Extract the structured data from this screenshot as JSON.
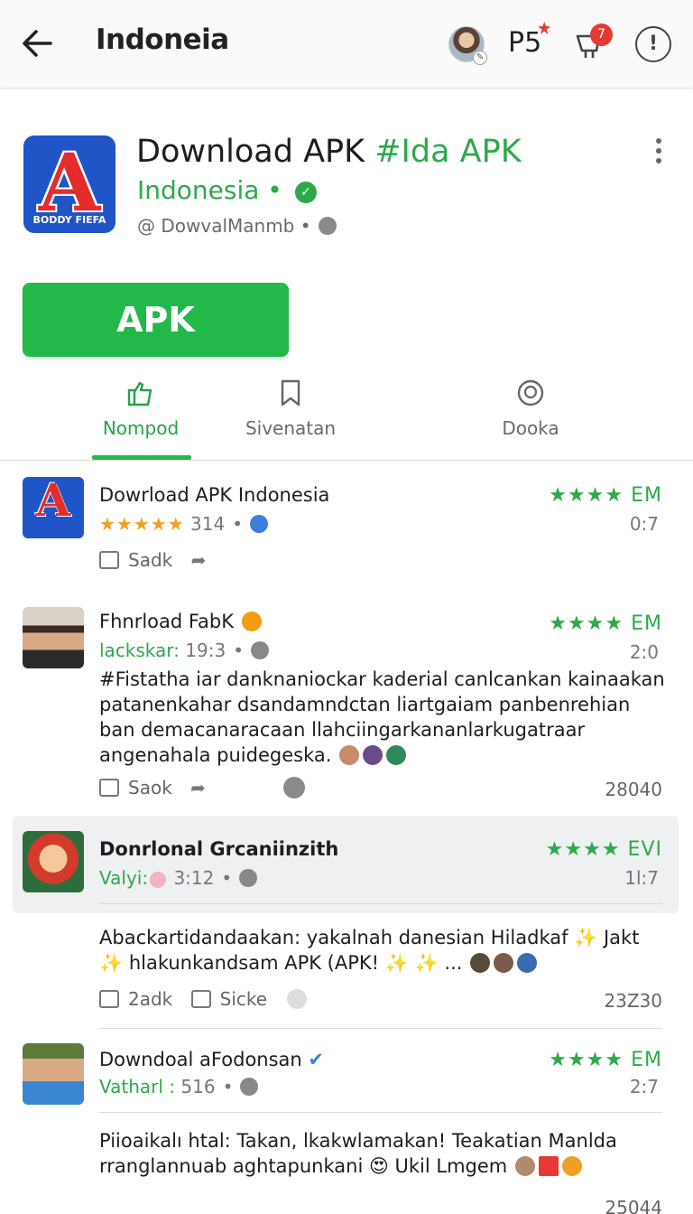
{
  "topbar": {
    "title": "Indoneia",
    "ps_label": "P5",
    "cart_badge": "7",
    "info_label": "!"
  },
  "app": {
    "icon_letter": "A",
    "icon_caption": "BODDY FIEFA",
    "title_main": "Download APK ",
    "title_accent": "#Ida APK",
    "subtitle": "Indonesia •",
    "verified_mark": "✓",
    "developer": "@  DowvalManmb  •"
  },
  "apk_button": {
    "label": "APK"
  },
  "tabs": [
    {
      "label": "Nompod",
      "icon": "thumbs-up-bag-icon",
      "active": true
    },
    {
      "label": "Sivenatan",
      "icon": "bookmark-icon",
      "active": false
    },
    {
      "label": "Dooka",
      "icon": "badge-icon",
      "active": false
    }
  ],
  "reviews": [
    {
      "name": "Dowrload APK Indonesia",
      "meta_stars": "★★★★★",
      "meta_value": "314",
      "stars": "★★★★ EM",
      "time": "0:7",
      "text": "",
      "action_label": "Sadk",
      "count": ""
    },
    {
      "name": "Fhnrload FabK",
      "meta_user": "lackskar:",
      "meta_value": "19:3",
      "stars": "★★★★ EM",
      "time": "2:0",
      "text": "#Fistatha iar danknaniockar kaderial canlcankan kainaakan patanenkahar dsandamndctan liartgaiam panbenrehian ban demacanaracaan llahciingarkananlarkugatraar angenahala puidegeska.",
      "action_label": "Saok",
      "count": "28040"
    },
    {
      "name": "Donrlonal Grcaniinzith",
      "meta_user": "Valyi:",
      "meta_value": "3:12",
      "stars": "★★★★ EVI",
      "time": "1l:7",
      "text": "Abackartidandaakan: yakalnah danesian Hiladkaf ✨ Jakt ✨ hlakunkandsam APK (APK! ✨ ✨ ...",
      "action_label": "2adk",
      "action_label_2": "Sicke",
      "count": "23Z30"
    },
    {
      "name": "Downdoal aFodonsan",
      "meta_user": "Vatharl :",
      "meta_value": "516",
      "stars": "★★★★ EM",
      "time": "2:7",
      "text": "Piioaikalı htal: Takan, lkakwlamakan!  Teakatian Manlda rranglannuab aghtapunkani 😍 Ukil Lmgem",
      "count": "25044"
    }
  ],
  "colors": {
    "accent_green": "#22b84a",
    "badge_red": "#e53935",
    "icon_blue": "#1f55c6"
  }
}
